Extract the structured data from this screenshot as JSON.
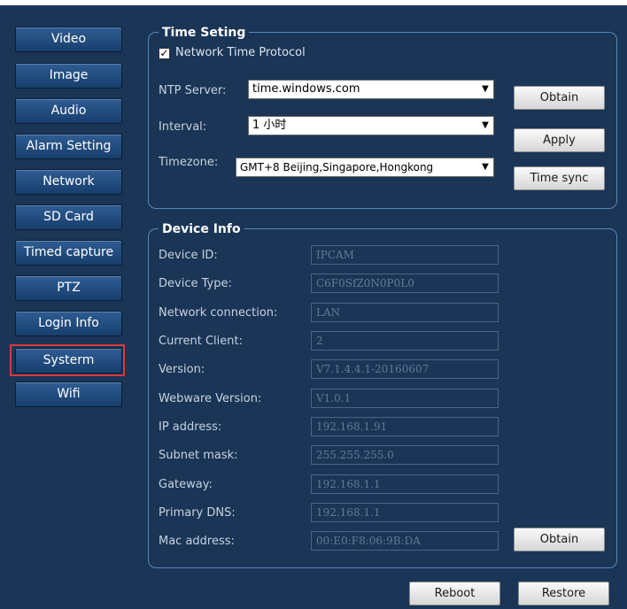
{
  "sidebar": {
    "items": [
      {
        "label": "Video"
      },
      {
        "label": "Image"
      },
      {
        "label": "Audio"
      },
      {
        "label": "Alarm Setting"
      },
      {
        "label": "Network"
      },
      {
        "label": "SD Card"
      },
      {
        "label": "Timed capture"
      },
      {
        "label": "PTZ"
      },
      {
        "label": "Login Info"
      },
      {
        "label": "Systerm"
      },
      {
        "label": "Wifi"
      }
    ],
    "selected": "Systerm"
  },
  "time_setting": {
    "title": "Time Seting",
    "ntp_checkbox": {
      "label": "Network Time Protocol",
      "checked": true
    },
    "ntp_server": {
      "label": "NTP Server:",
      "value": "time.windows.com"
    },
    "interval": {
      "label": "Interval:",
      "value": "1 小时"
    },
    "timezone": {
      "label": "Timezone:",
      "value": "GMT+8  Beijing,Singapore,Hongkong"
    },
    "buttons": {
      "obtain": "Obtain",
      "apply": "Apply",
      "time_sync": "Time sync"
    }
  },
  "device_info": {
    "title": "Device Info",
    "fields": [
      {
        "label": "Device ID:",
        "value": "IPCAM"
      },
      {
        "label": "Device Type:",
        "value": "C6F0SfZ0N0P0L0"
      },
      {
        "label": "Network connection:",
        "value": "LAN"
      },
      {
        "label": "Current Client:",
        "value": "2"
      },
      {
        "label": "Version:",
        "value": "V7.1.4.4.1-20160607"
      },
      {
        "label": "Webware Version:",
        "value": "V1.0.1"
      },
      {
        "label": "IP address:",
        "value": "192.168.1.91"
      },
      {
        "label": "Subnet mask:",
        "value": "255.255.255.0"
      },
      {
        "label": "Gateway:",
        "value": "192.168.1.1"
      },
      {
        "label": "Primary DNS:",
        "value": "192.168.1.1"
      },
      {
        "label": "Mac address:",
        "value": "00:E0:F8:06:9B:DA"
      }
    ],
    "obtain_button": "Obtain"
  },
  "footer": {
    "reboot": "Reboot",
    "restore": "Restore"
  },
  "colors": {
    "background": "#1a3556",
    "highlight": "#e0373a",
    "border": "#5b86b6"
  },
  "icons": {
    "checkbox": "check-icon",
    "dropdown": "triangle-down-icon"
  }
}
